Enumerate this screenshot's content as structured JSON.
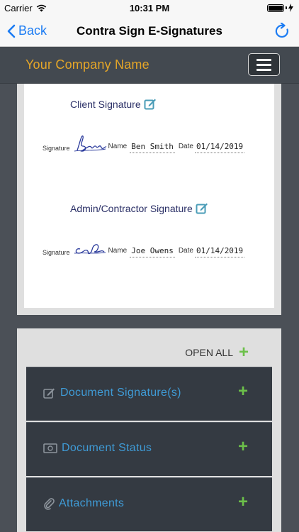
{
  "status_bar": {
    "carrier": "Carrier",
    "time": "10:31 PM"
  },
  "nav": {
    "back_label": "Back",
    "title": "Contra Sign E-Signatures"
  },
  "header": {
    "company_name": "Your Company Name"
  },
  "signatures": {
    "client": {
      "title": "Client Signature",
      "signature_label": "Signature",
      "name_label": "Name",
      "name_value": "Ben Smith",
      "date_label": "Date",
      "date_value": "01/14/2019"
    },
    "admin": {
      "title": "Admin/Contractor Signature",
      "signature_label": "Signature",
      "name_label": "Name",
      "name_value": "Joe Owens",
      "date_label": "Date",
      "date_value": "01/14/2019"
    }
  },
  "sections": {
    "open_all_label": "OPEN ALL",
    "items": [
      {
        "label": "Document Signature(s)",
        "icon": "edit-icon"
      },
      {
        "label": "Document Status",
        "icon": "money-icon"
      },
      {
        "label": "Attachments",
        "icon": "paperclip-icon"
      }
    ]
  },
  "colors": {
    "company_name": "#e5a628",
    "accent_blue": "#1c7cf3",
    "section_label": "#3f9bd6",
    "plus_green": "#6cc04a",
    "edit_icon": "#4a9cb7"
  }
}
